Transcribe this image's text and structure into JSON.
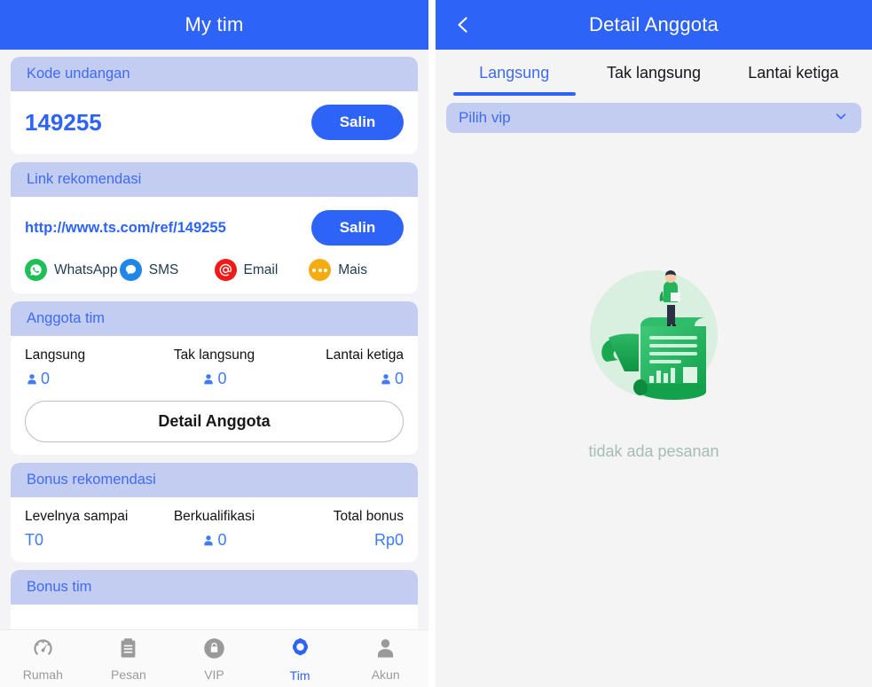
{
  "left": {
    "appbar": {
      "title": "My tim"
    },
    "invite_card": {
      "header": "Kode undangan",
      "code": "149255",
      "copy_label": "Salin"
    },
    "link_card": {
      "header": "Link rekomendasi",
      "url": "http://www.ts.com/ref/149255",
      "copy_label": "Salin",
      "share": [
        {
          "label": "WhatsApp",
          "icon": "whatsapp-icon",
          "color": "#1fbf57"
        },
        {
          "label": "SMS",
          "icon": "sms-icon",
          "color": "#1e86e8"
        },
        {
          "label": "Email",
          "icon": "email-icon",
          "color": "#f01b18"
        },
        {
          "label": "Mais",
          "icon": "more-icon",
          "color": "#f6ab10"
        }
      ]
    },
    "members_card": {
      "header": "Anggota tim",
      "stats": [
        {
          "label": "Langsung",
          "value": "0",
          "icon": "person-icon"
        },
        {
          "label": "Tak langsung",
          "value": "0",
          "icon": "person-icon"
        },
        {
          "label": "Lantai ketiga",
          "value": "0",
          "icon": "person-icon"
        }
      ],
      "detail_button": "Detail Anggota"
    },
    "referral_bonus_card": {
      "header": "Bonus rekomendasi",
      "stats": [
        {
          "label": "Levelnya sampai",
          "value": "T0",
          "icon": ""
        },
        {
          "label": "Berkualifikasi",
          "value": "0",
          "icon": "person-icon"
        },
        {
          "label": "Total bonus",
          "value": "Rp0",
          "icon": ""
        }
      ]
    },
    "team_bonus_card": {
      "header": "Bonus tim"
    },
    "tabbar": {
      "items": [
        {
          "label": "Rumah",
          "icon": "speedometer-icon",
          "active": false
        },
        {
          "label": "Pesan",
          "icon": "clipboard-icon",
          "active": false
        },
        {
          "label": "VIP",
          "icon": "shopping-bag-icon",
          "active": false
        },
        {
          "label": "Tim",
          "icon": "gear-icon",
          "active": true
        },
        {
          "label": "Akun",
          "icon": "person-icon",
          "active": false
        }
      ]
    }
  },
  "right": {
    "appbar": {
      "title": "Detail Anggota",
      "back_icon": "chevron-left-icon"
    },
    "tabs": [
      {
        "label": "Langsung",
        "active": true
      },
      {
        "label": "Tak langsung",
        "active": false
      },
      {
        "label": "Lantai ketiga",
        "active": false
      }
    ],
    "vip_select": {
      "value": "Pilih vip",
      "chevron": "chevron-down-icon"
    },
    "empty_state": {
      "text": "tidak ada pesanan",
      "illustration": "person-on-scroll-illustration"
    }
  },
  "theme": {
    "primary": "#2d63f6",
    "card_header_bg": "#c3cdf2",
    "card_header_text": "#3f6af5",
    "page_bg": "#f4f4f6"
  }
}
